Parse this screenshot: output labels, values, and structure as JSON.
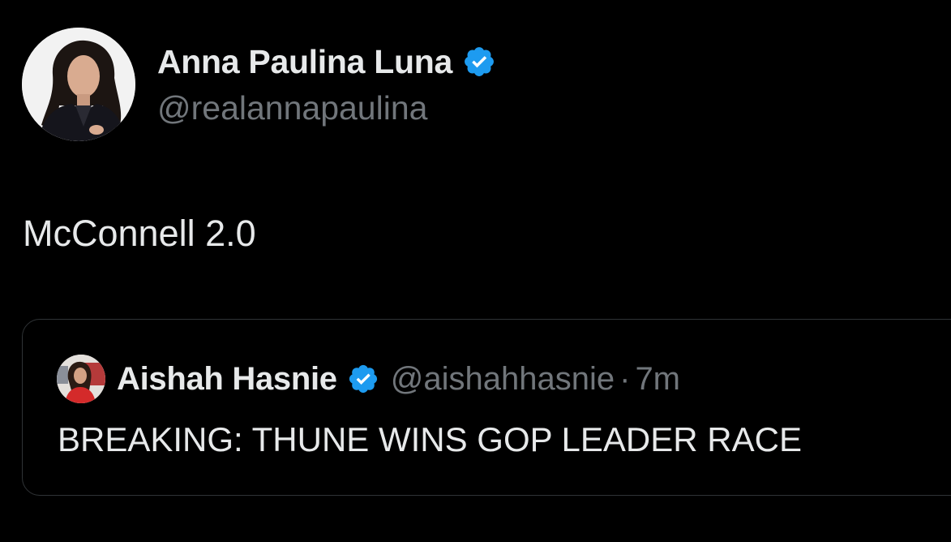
{
  "tweet": {
    "author": {
      "name": "Anna Paulina Luna",
      "handle": "@realannapaulina",
      "verified": true,
      "avatar_icon": "profile-photo"
    },
    "text": "McConnell 2.0"
  },
  "quote": {
    "author": {
      "name": "Aishah Hasnie",
      "handle": "@aishahhasnie",
      "verified": true,
      "avatar_icon": "profile-photo"
    },
    "separator": "·",
    "time": "7m",
    "text": "BREAKING: THUNE WINS GOP LEADER RACE"
  },
  "colors": {
    "background": "#000000",
    "primary_text": "#e7e9ea",
    "secondary_text": "#71767b",
    "verified_badge": "#1d9bf0",
    "card_border": "#2f3336"
  }
}
